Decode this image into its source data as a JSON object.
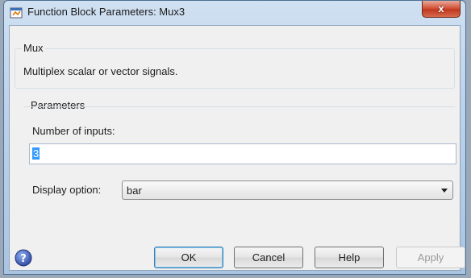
{
  "window": {
    "title": "Function Block Parameters: Mux3",
    "close_glyph": "x"
  },
  "block": {
    "name": "Mux",
    "description": "Multiplex scalar or vector signals."
  },
  "parameters": {
    "group_label": "Parameters",
    "inputs_label": "Number of inputs:",
    "inputs_value": "3",
    "display_label": "Display option:",
    "display_value": "bar"
  },
  "buttons": {
    "ok": "OK",
    "cancel": "Cancel",
    "help": "Help",
    "apply": "Apply"
  },
  "colors": {
    "selection": "#3399ff",
    "close_button": "#c0381f",
    "help_icon": "#3f5fb0"
  }
}
